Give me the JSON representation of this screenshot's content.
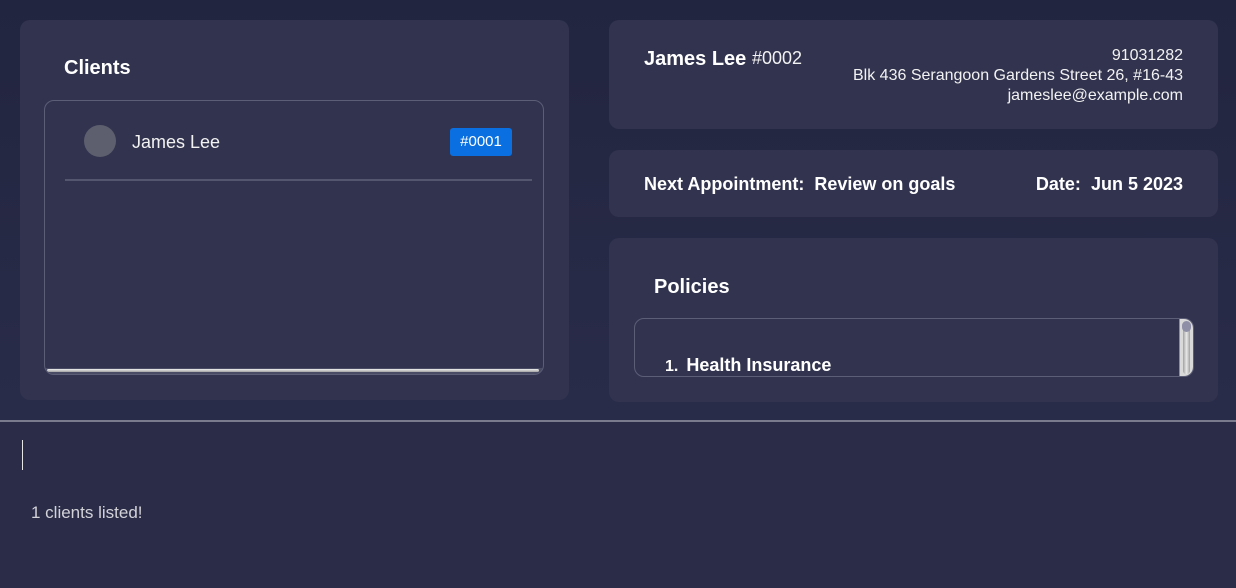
{
  "clients_panel": {
    "title": "Clients",
    "clients": [
      {
        "name": "James Lee",
        "id_tag": "#0001"
      }
    ]
  },
  "contact": {
    "name": "James Lee",
    "id": "#0002",
    "phone": "91031282",
    "address": "Blk 436 Serangoon Gardens Street 26, #16-43",
    "email": "jameslee@example.com"
  },
  "appointment": {
    "label": "Next Appointment:",
    "value": "Review on goals",
    "date_label": "Date:",
    "date_value": "Jun 5 2023"
  },
  "policies_panel": {
    "title": "Policies",
    "policies": [
      {
        "index": "1.",
        "name": "Health Insurance"
      }
    ]
  },
  "command": {
    "value": "",
    "placeholder": ""
  },
  "result": {
    "message": "1 clients listed!"
  },
  "colors": {
    "background": "#242742",
    "panel": "#32344f",
    "tag_blue": "#0a6fe0",
    "avatar": "#5d5f6e"
  }
}
